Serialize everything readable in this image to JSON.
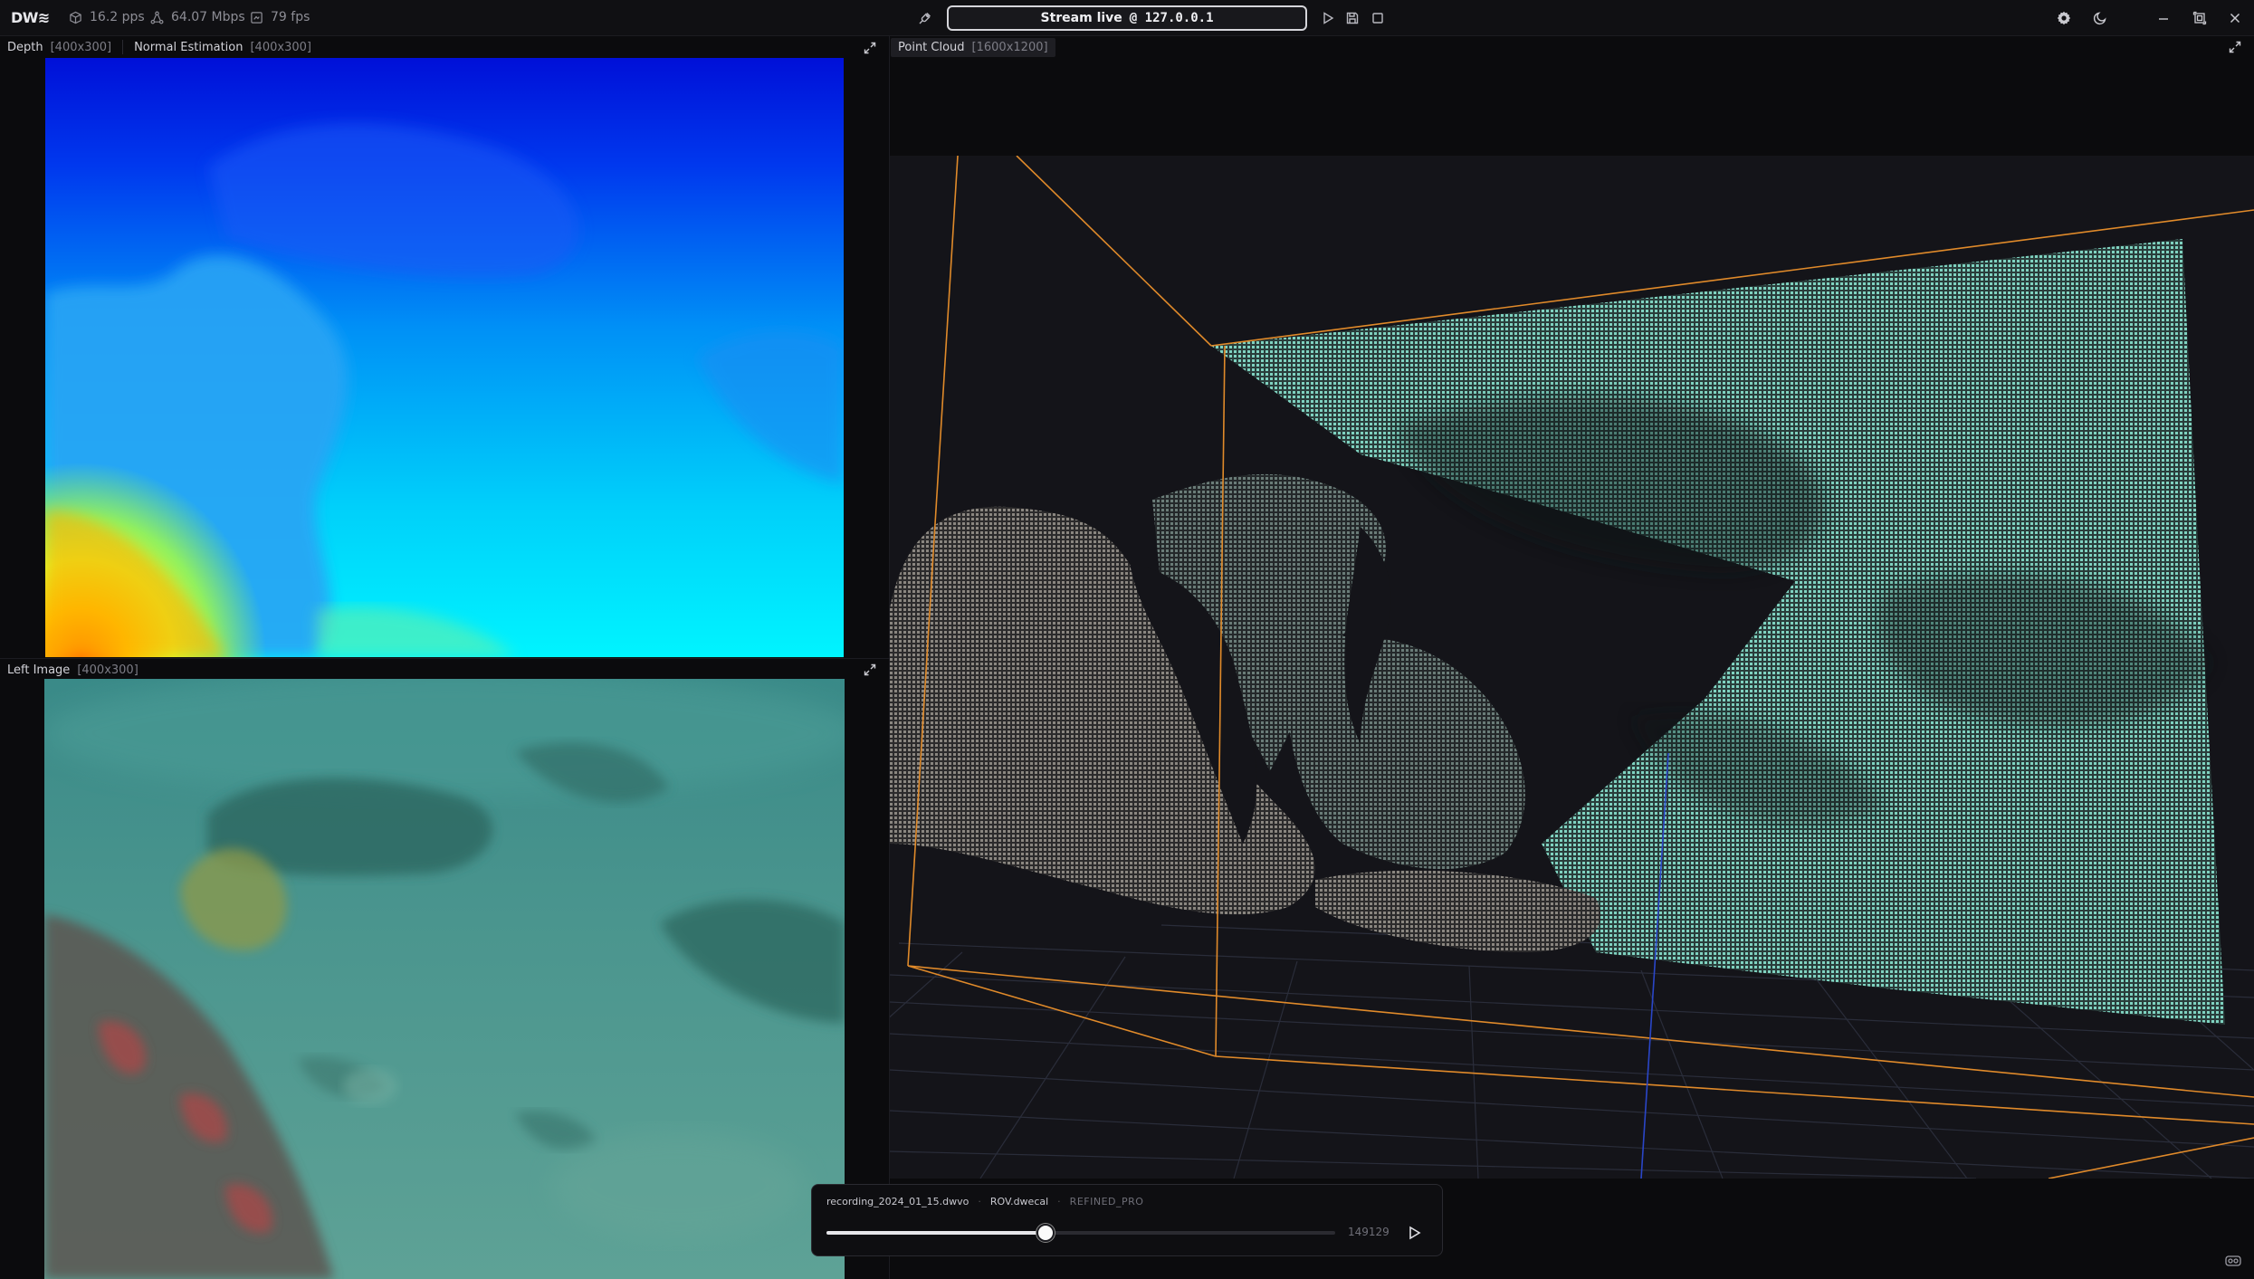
{
  "app": {
    "logo": "DW≋"
  },
  "stats": [
    {
      "icon": "cube-icon",
      "value": "16.2 pps"
    },
    {
      "icon": "network-icon",
      "value": "64.07 Mbps"
    },
    {
      "icon": "frame-icon",
      "value": "79 fps"
    }
  ],
  "stream": {
    "label": "Stream live",
    "address": "@ 127.0.0.1"
  },
  "panels": {
    "depth": {
      "title": "Depth",
      "size": "[400x300]"
    },
    "normals": {
      "title": "Normal Estimation",
      "size": "[400x300]"
    },
    "left_image": {
      "title": "Left Image",
      "size": "[400x300]"
    },
    "point_cloud": {
      "title": "Point Cloud",
      "size": "[1600x1200]"
    }
  },
  "player": {
    "recording": "recording_2024_01_15.dwvo",
    "calibration": "ROV.dwecal",
    "mode": "REFINED_PRO",
    "frame": "149129",
    "progress": 0.43
  },
  "colors": {
    "accent_orange": "#e08a2a",
    "cloud_teal": "#6fc4b3",
    "topbar_bg": "#101013"
  }
}
